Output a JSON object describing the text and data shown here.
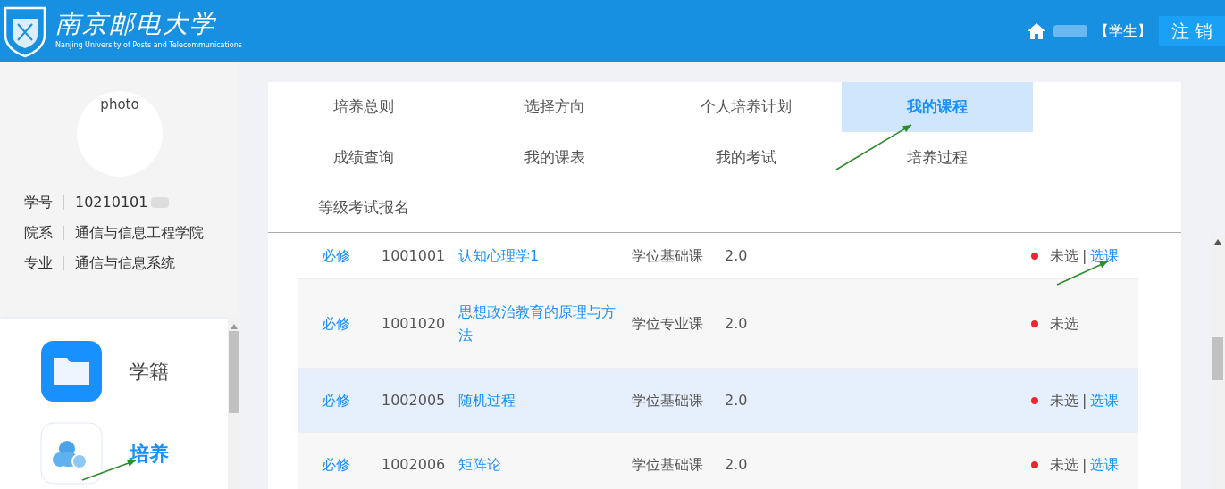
{
  "header": {
    "logo_text": "南京邮电大学",
    "logo_subtitle": "Nanjing University of Posts and Telecommunications",
    "role": "【学生】",
    "logout_button": "注 销"
  },
  "profile": {
    "photo_alt": "photo",
    "fields": [
      {
        "label": "学号",
        "value": "10210101"
      },
      {
        "label": "院系",
        "value": "通信与信息工程学院"
      },
      {
        "label": "专业",
        "value": "通信与信息系统"
      }
    ]
  },
  "sidebar": {
    "items": [
      {
        "label": "学籍",
        "kind": "folder",
        "selected": false
      },
      {
        "label": "培养",
        "kind": "cloud",
        "selected": true
      }
    ]
  },
  "tabs": [
    {
      "label": "培养总则",
      "selected": false
    },
    {
      "label": "选择方向",
      "selected": false
    },
    {
      "label": "个人培养计划",
      "selected": false
    },
    {
      "label": "我的课程",
      "selected": true
    },
    {
      "label": "成绩查询",
      "selected": false
    },
    {
      "label": "我的课表",
      "selected": false
    },
    {
      "label": "我的考试",
      "selected": false
    },
    {
      "label": "培养过程",
      "selected": false
    },
    {
      "label": "等级考试报名",
      "selected": false
    }
  ],
  "table": {
    "rows": [
      {
        "type": "必修",
        "code": "1001001",
        "name": "认知心理学1",
        "category": "学位基础课",
        "credit": "2.0",
        "status": "未选",
        "color": "#f0262f",
        "separator": "|",
        "action": "选课",
        "highlighted": false
      },
      {
        "type": "必修",
        "code": "1001020",
        "name": "思想政治教育的原理与方法",
        "category": "学位专业课",
        "credit": "2.0",
        "status": "未选",
        "color": "#f0262f",
        "highlighted": false
      },
      {
        "type": "必修",
        "code": "1002005",
        "name": "随机过程",
        "category": "学位基础课",
        "credit": "2.0",
        "status": "未选",
        "color": "#f0262f",
        "separator": "|",
        "action": "选课",
        "highlighted": true
      },
      {
        "type": "必修",
        "code": "1002006",
        "name": "矩阵论",
        "category": "学位基础课",
        "credit": "2.0",
        "status": "未选",
        "color": "#f0262f",
        "separator": "|",
        "action": "选课",
        "highlighted": false
      }
    ]
  }
}
